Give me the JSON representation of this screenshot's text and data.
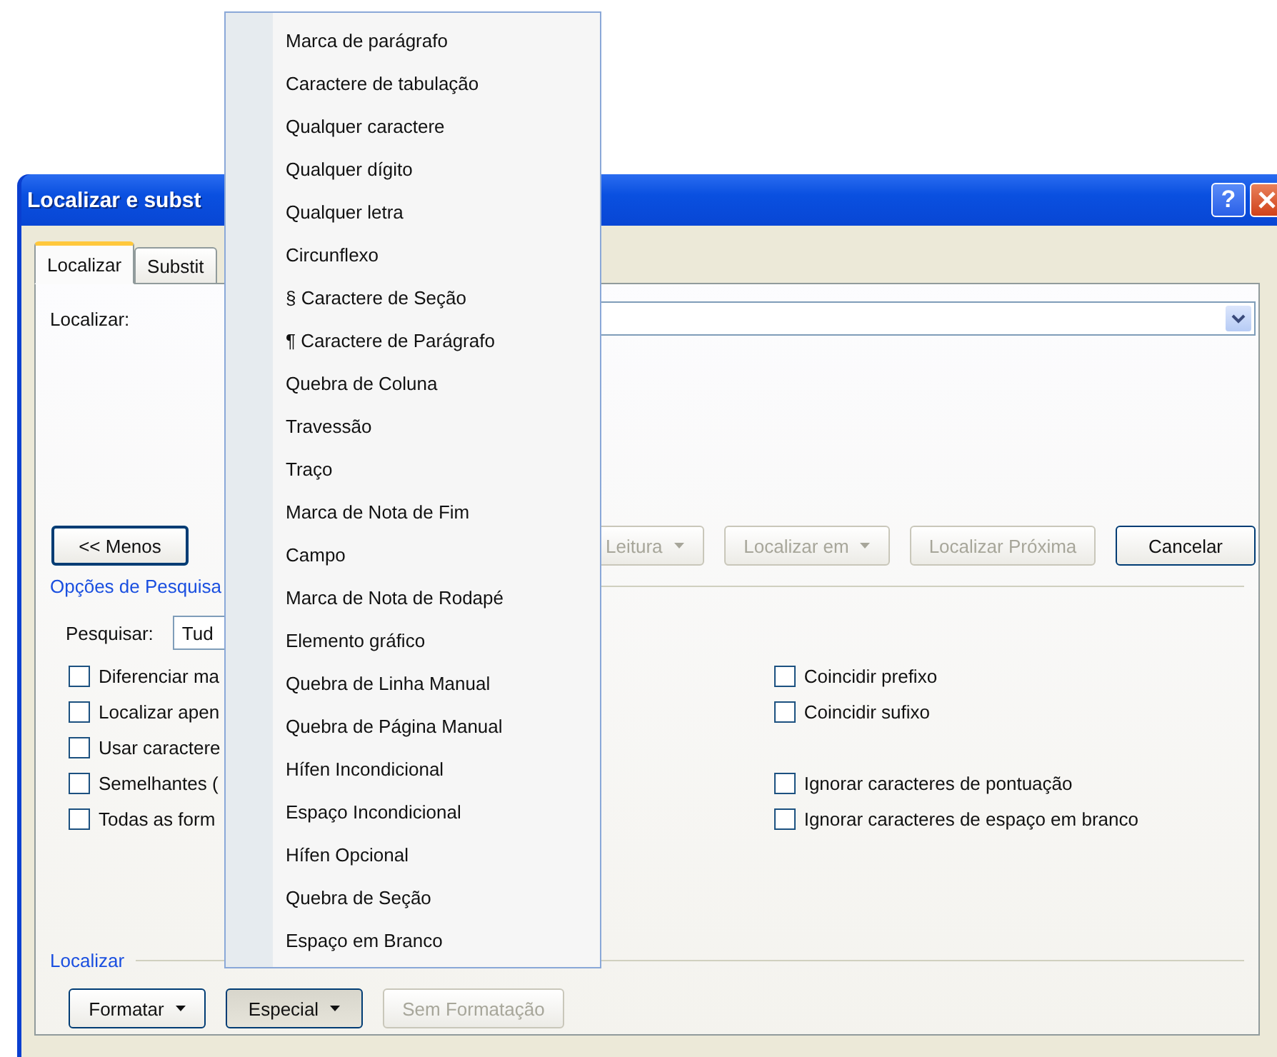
{
  "window": {
    "title": "Localizar e subst",
    "help": "?"
  },
  "tabs": [
    {
      "label": "Localizar",
      "selected": true
    },
    {
      "label": "Substit",
      "selected": false
    }
  ],
  "find": {
    "label": "Localizar:"
  },
  "less_button": {
    "label": "<< Menos"
  },
  "actions": [
    {
      "label": "Leitura",
      "dropdown": true,
      "disabled": true
    },
    {
      "label": "Localizar em",
      "dropdown": true,
      "disabled": true
    },
    {
      "label": "Localizar Próxima",
      "dropdown": false,
      "disabled": true
    },
    {
      "label": "Cancelar",
      "dropdown": false,
      "disabled": false
    }
  ],
  "search_options": {
    "title": "Opções de Pesquisa",
    "search_label": "Pesquisar:",
    "search_value": "Tud",
    "left": [
      {
        "label": "Diferenciar ma",
        "checked": false
      },
      {
        "label": "Localizar apen",
        "checked": false
      },
      {
        "label": "Usar caractere",
        "checked": false
      },
      {
        "label": "Semelhantes (",
        "checked": false
      },
      {
        "label": "Todas as form",
        "checked": false
      }
    ],
    "match": [
      {
        "label": "Coincidir prefixo",
        "checked": false
      },
      {
        "label": "Coincidir sufixo",
        "checked": false
      }
    ],
    "ignore": [
      {
        "label": "Ignorar caracteres de pontuação",
        "checked": false
      },
      {
        "label": "Ignorar caracteres de espaço em branco",
        "checked": false
      }
    ]
  },
  "footer": {
    "title": "Localizar",
    "buttons": [
      {
        "label": "Formatar",
        "dropdown": true,
        "disabled": false,
        "pressed": false
      },
      {
        "label": "Especial",
        "dropdown": true,
        "disabled": false,
        "pressed": true
      },
      {
        "label": "Sem Formatação",
        "dropdown": false,
        "disabled": true,
        "pressed": false
      }
    ]
  },
  "menu": {
    "items": [
      "Marca de parágrafo",
      "Caractere de tabulação",
      "Qualquer caractere",
      "Qualquer dígito",
      "Qualquer letra",
      "Circunflexo",
      "§ Caractere de Seção",
      "¶ Caractere de Parágrafo",
      "Quebra de Coluna",
      "Travessão",
      "Traço",
      "Marca de Nota de Fim",
      "Campo",
      "Marca de Nota de Rodapé",
      "Elemento gráfico",
      "Quebra de Linha Manual",
      "Quebra de Página Manual",
      "Hífen Incondicional",
      "Espaço Incondicional",
      "Hífen Opcional",
      "Quebra de Seção",
      "Espaço em Branco"
    ]
  }
}
